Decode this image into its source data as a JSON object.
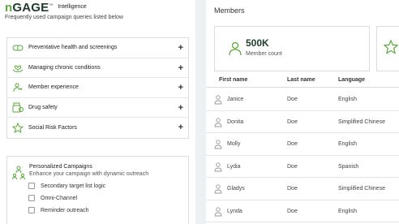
{
  "brand": {
    "logo_prefix": "n",
    "logo_main": "GAGE",
    "logo_tm": "™",
    "product": "Intelligence",
    "subtitle": "Frequently used campaign queries listed below"
  },
  "queries": [
    {
      "label": "Preventative health and screenings",
      "icon": "pill-icon"
    },
    {
      "label": "Managing chronic conditions",
      "icon": "heart-hands-icon"
    },
    {
      "label": "Member experience",
      "icon": "person-heart-icon"
    },
    {
      "label": "Drug safety",
      "icon": "pill-bottle-icon"
    },
    {
      "label": "Social Risk Factors",
      "icon": "star-icon"
    }
  ],
  "personalized": {
    "title": "Personalized Campaigns",
    "subtitle": "Enhance your campaign with dynamic outreach",
    "options": [
      "Secondary target list logic",
      "Omni-Channel",
      "Reminder outreach"
    ]
  },
  "members": {
    "title": "Members",
    "stat_value": "500K",
    "stat_label": "Member count",
    "columns": [
      "First name",
      "Last name",
      "Language"
    ],
    "rows": [
      [
        "Janice",
        "Doe",
        "English"
      ],
      [
        "Donita",
        "Doe",
        "Simplified Chinese"
      ],
      [
        "Molly",
        "Doe",
        "English"
      ],
      [
        "Lydia",
        "Doe",
        "Spanish"
      ],
      [
        "Gladys",
        "Doe",
        "Simplified Chinese"
      ],
      [
        "Lynda",
        "Doe",
        "English"
      ]
    ]
  },
  "colors": {
    "accent": "#5aa83a",
    "brand_dark": "#1e3b2c"
  }
}
